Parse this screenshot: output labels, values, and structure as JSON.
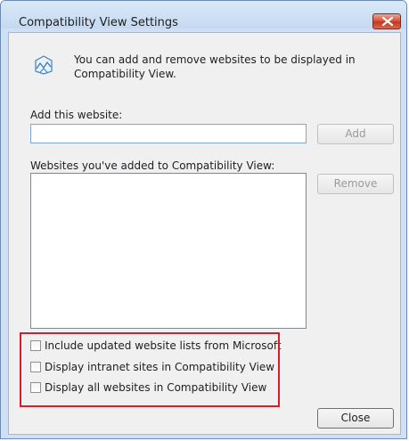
{
  "window": {
    "title": "Compatibility View Settings",
    "close_icon": "close-icon"
  },
  "info": {
    "icon": "compatibility-view-icon",
    "text": "You can add and remove websites to be displayed in Compatibility View."
  },
  "add_website": {
    "label": "Add this website:",
    "value": "",
    "button_label": "Add",
    "button_enabled": false
  },
  "websites_list": {
    "label": "Websites you've added to Compatibility View:",
    "items": [],
    "remove_button_label": "Remove",
    "remove_button_enabled": false
  },
  "options": [
    {
      "label": "Include updated website lists from Microsoft",
      "checked": false
    },
    {
      "label": "Display intranet sites in Compatibility View",
      "checked": false
    },
    {
      "label": "Display all websites in Compatibility View",
      "checked": false
    }
  ],
  "highlight_color": "#d0202a",
  "close_button_label": "Close"
}
